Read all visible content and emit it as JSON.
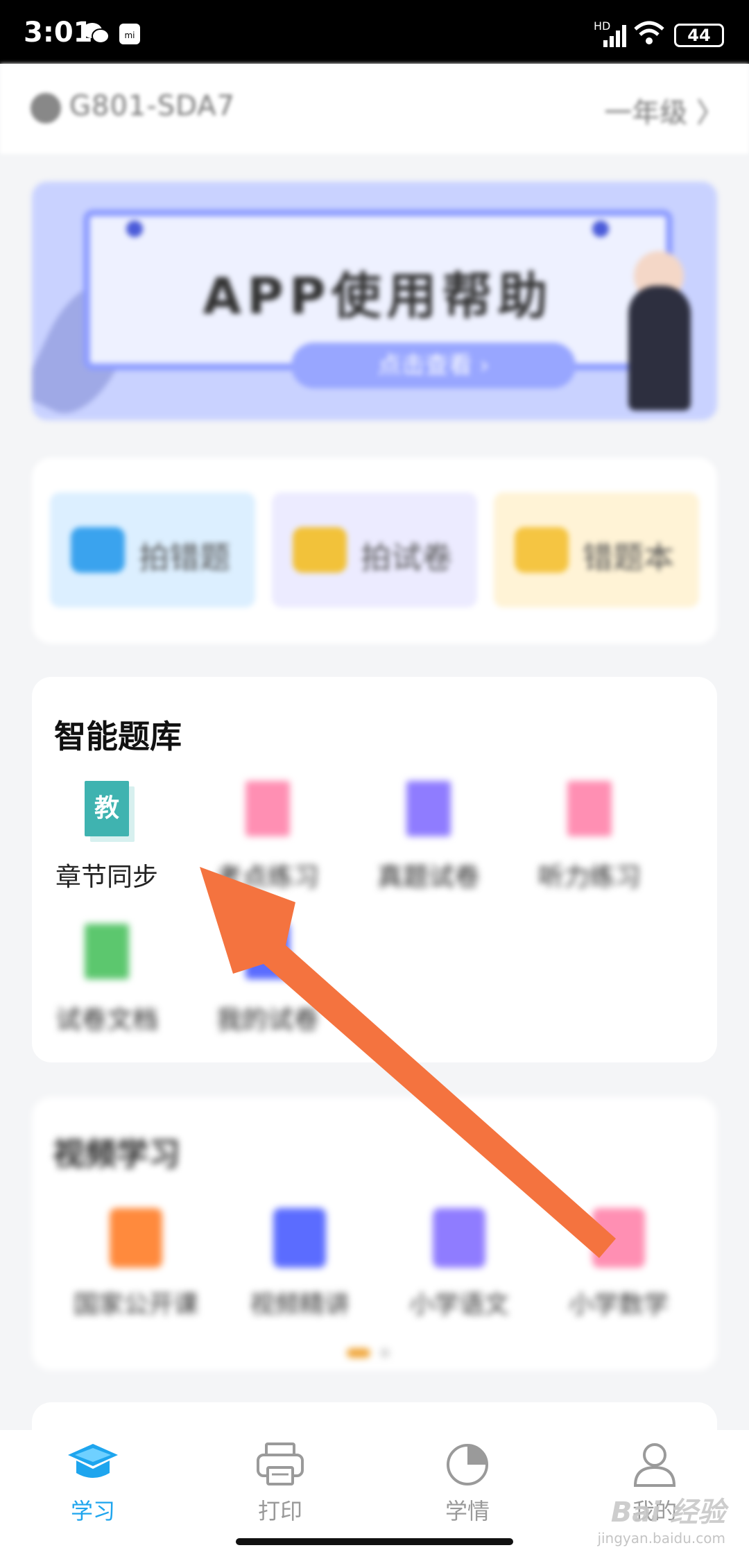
{
  "status_bar": {
    "time": "3:01",
    "battery": "44",
    "network": "HD",
    "icons": [
      "wechat-icon",
      "mi-icon",
      "signal-icon",
      "wifi-icon",
      "battery-icon"
    ]
  },
  "header": {
    "device_id": "G801-SDA7",
    "grade": "一年级 〉"
  },
  "banner": {
    "title": "APP使用帮助",
    "button": "点击查看 ›"
  },
  "quick_actions": [
    {
      "label": "拍错题",
      "icon": "camera-icon",
      "bg": "#dcefff",
      "icon_color": "#3aa3ee"
    },
    {
      "label": "拍试卷",
      "icon": "camera-icon",
      "bg": "#ecebff",
      "icon_color": "#f2c23a"
    },
    {
      "label": "错题本",
      "icon": "book-icon",
      "bg": "#fff3d6",
      "icon_color": "#f5c542"
    }
  ],
  "question_bank": {
    "title": "智能题库",
    "items": [
      {
        "label": "章节同步",
        "icon_text": "教",
        "color": "#3fb3b0"
      },
      {
        "label": "考点练习",
        "color": "#ff8fb3"
      },
      {
        "label": "真题试卷",
        "color": "#8f7cff"
      },
      {
        "label": "听力练习",
        "color": "#ff8fb3"
      },
      {
        "label": "试卷文档",
        "color": "#5cc76e"
      },
      {
        "label": "我的试卷",
        "color": "#5b6cff"
      }
    ]
  },
  "video": {
    "title": "视频学习",
    "items": [
      {
        "label": "国家公开课",
        "color": "#ff8a3d"
      },
      {
        "label": "视频精讲",
        "color": "#5b6cff"
      },
      {
        "label": "小学语文",
        "color": "#8f7cff"
      },
      {
        "label": "小学数学",
        "color": "#ff8fb3"
      }
    ]
  },
  "tabs": [
    {
      "label": "学习",
      "icon": "graduation-cap-icon",
      "active": true
    },
    {
      "label": "打印",
      "icon": "printer-icon",
      "active": false
    },
    {
      "label": "学情",
      "icon": "pie-chart-icon",
      "active": false
    },
    {
      "label": "我的",
      "icon": "user-icon",
      "active": false
    }
  ],
  "watermark": {
    "main": "Bai 经验",
    "sub": "jingyan.baidu.com"
  },
  "colors": {
    "arrow": "#f4733f",
    "accent": "#1ea5ee"
  }
}
